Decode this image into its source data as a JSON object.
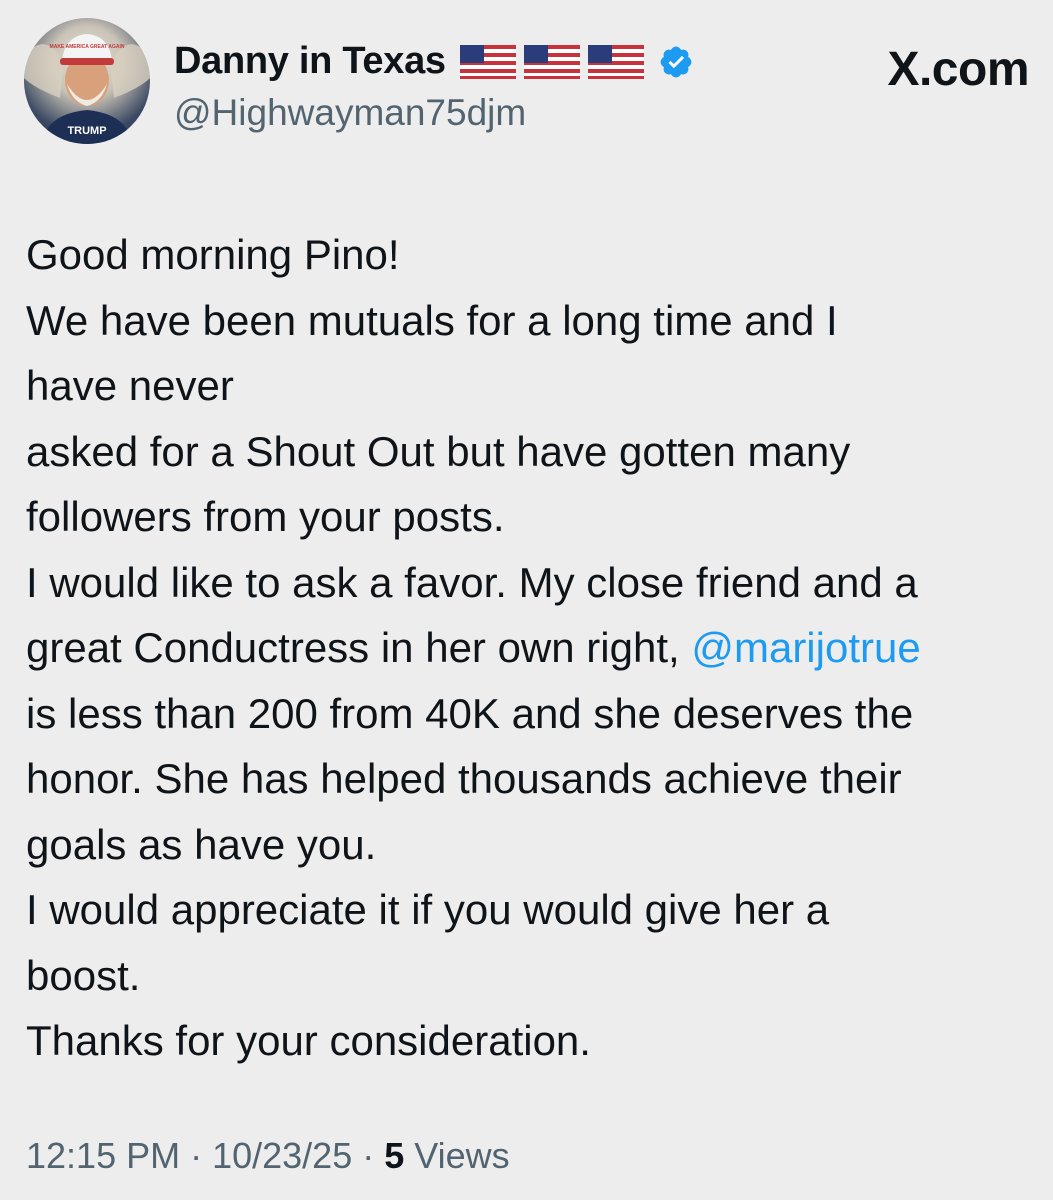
{
  "header": {
    "display_name": "Danny in Texas",
    "flags": [
      "flag-us",
      "flag-us",
      "flag-us"
    ],
    "verified_icon": "verified-badge-icon",
    "handle": "@Highwayman75djm",
    "brand": "X.com",
    "avatar": {
      "hat_text": "MAKE AMERICA GREAT AGAIN",
      "shirt_text": "TRUMP"
    }
  },
  "post": {
    "lines": [
      "Good morning Pino!",
      "We have been mutuals for a long time and I",
      "have never",
      "asked for a Shout Out but have gotten many",
      "followers from your posts.",
      "I would like to ask a favor. My close friend and a",
      "great Conductress in her own right, ",
      "is less than 200 from 40K and she deserves the",
      "honor. She has helped thousands achieve their",
      "goals as have you.",
      "I would appreciate it if you would give her a",
      "boost.",
      "Thanks for your consideration."
    ],
    "mention": "@marijotrue"
  },
  "meta": {
    "time": "12:15 PM",
    "separator": " · ",
    "date": "10/23/25",
    "views_count": "5",
    "views_label": " Views"
  },
  "colors": {
    "background": "#ededee",
    "text": "#0f1419",
    "secondary": "#536471",
    "link": "#1d9bf0",
    "verified": "#1d9bf0"
  }
}
